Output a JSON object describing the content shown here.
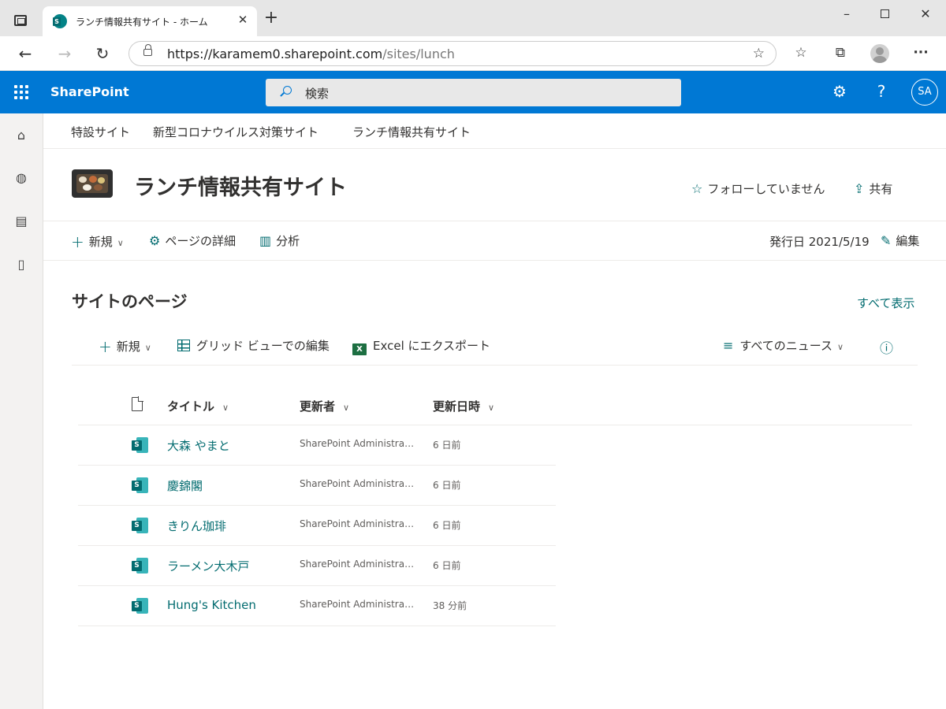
{
  "browser": {
    "tab_title": "ランチ情報共有サイト - ホーム",
    "tab_close": "✕",
    "new_tab": "+",
    "url_host": "https://karamem0.sharepoint.com",
    "url_path": "/sites/lunch",
    "window_min": "–",
    "window_close": "✕"
  },
  "suite": {
    "brand": "SharePoint",
    "search_placeholder": "検索",
    "avatar_initials": "SA"
  },
  "hub_nav": [
    "特設サイト",
    "新型コロナウイルス対策サイト",
    "ランチ情報共有サイト"
  ],
  "site": {
    "title": "ランチ情報共有サイト",
    "follow_label": "フォローしていません",
    "share_label": "共有"
  },
  "command_bar": {
    "new_label": "新規",
    "page_details_label": "ページの詳細",
    "analytics_label": "分析",
    "published": "発行日 2021/5/19",
    "edit_label": "編集"
  },
  "webpart": {
    "title": "サイトのページ",
    "see_all": "すべて表示",
    "library_bar": {
      "new_label": "新規",
      "grid_edit_label": "グリッド ビューでの編集",
      "excel_export_label": "Excel にエクスポート",
      "view_label": "すべてのニュース"
    },
    "columns": {
      "title": "タイトル",
      "modified_by": "更新者",
      "modified": "更新日時"
    },
    "rows": [
      {
        "title": "大森 やまと",
        "modified_by": "SharePoint Administrator",
        "modified": "6 日前"
      },
      {
        "title": "慶錦閣",
        "modified_by": "SharePoint Administrator",
        "modified": "6 日前"
      },
      {
        "title": "きりん珈琲",
        "modified_by": "SharePoint Administrator",
        "modified": "6 日前"
      },
      {
        "title": "ラーメン大木戸",
        "modified_by": "SharePoint Administrator",
        "modified": "6 日前"
      },
      {
        "title": "Hung's Kitchen",
        "modified_by": "SharePoint Administrator",
        "modified": "38 分前"
      }
    ]
  },
  "colors": {
    "suite_bar": "#0078d4",
    "theme_teal": "#036c70",
    "text": "#323130"
  }
}
